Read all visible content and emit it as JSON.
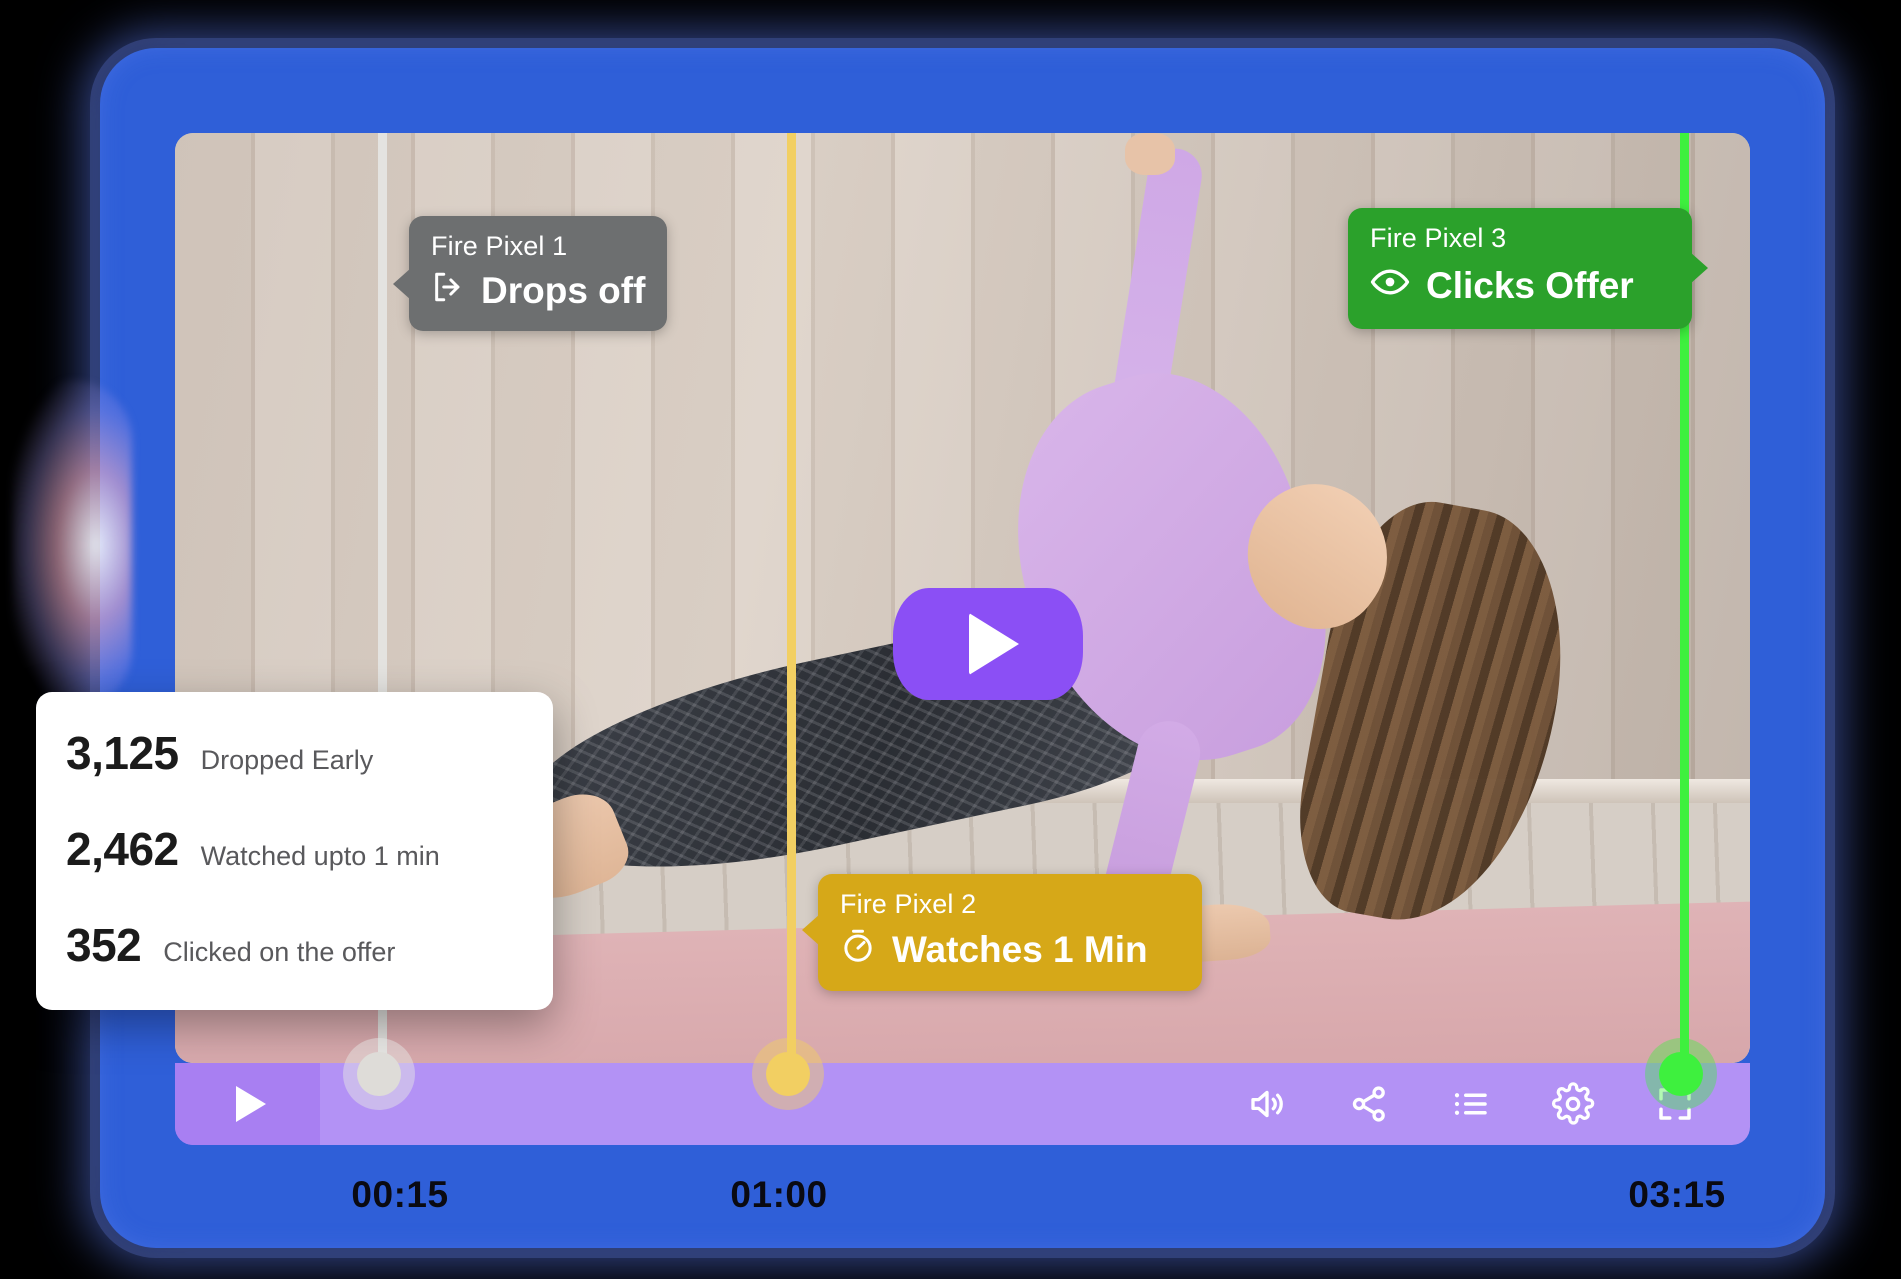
{
  "theme": {
    "frame_blue": "#2f5fd8",
    "bar_purple": "#b392f5",
    "play_purple": "#8b4ff5",
    "pixel1_color": "#6d6f70",
    "pixel2_color": "#d6a818",
    "pixel3_color": "#2ba12b"
  },
  "video_player": {
    "center_play_icon": "play-icon",
    "controls": {
      "play_label": "play-icon",
      "icons": [
        {
          "name": "volume-icon",
          "label": "Volume"
        },
        {
          "name": "share-icon",
          "label": "Share"
        },
        {
          "name": "playlist-icon",
          "label": "Playlist"
        },
        {
          "name": "settings-gear-icon",
          "label": "Settings"
        },
        {
          "name": "fullscreen-icon",
          "label": "Fullscreen"
        }
      ]
    },
    "timeline": {
      "markers": [
        {
          "id": "m1",
          "time": "00:15",
          "color": "#dedcd8"
        },
        {
          "id": "m2",
          "time": "01:00",
          "color": "#f2cf62"
        },
        {
          "id": "m3",
          "time": "03:15",
          "color": "#3ef03e"
        }
      ]
    }
  },
  "pixels": [
    {
      "title": "Fire Pixel 1",
      "action": "Drops off",
      "icon": "logout-icon",
      "color": "#6d6f70"
    },
    {
      "title": "Fire Pixel 2",
      "action": "Watches 1 Min",
      "icon": "stopwatch-icon",
      "color": "#d6a818"
    },
    {
      "title": "Fire Pixel 3",
      "action": "Clicks Offer",
      "icon": "eye-icon",
      "color": "#2ba12b"
    }
  ],
  "stats_card": {
    "rows": [
      {
        "value": "3,125",
        "label": "Dropped Early"
      },
      {
        "value": "2,462",
        "label": "Watched upto 1 min"
      },
      {
        "value": "352",
        "label": "Clicked on the offer"
      }
    ]
  }
}
